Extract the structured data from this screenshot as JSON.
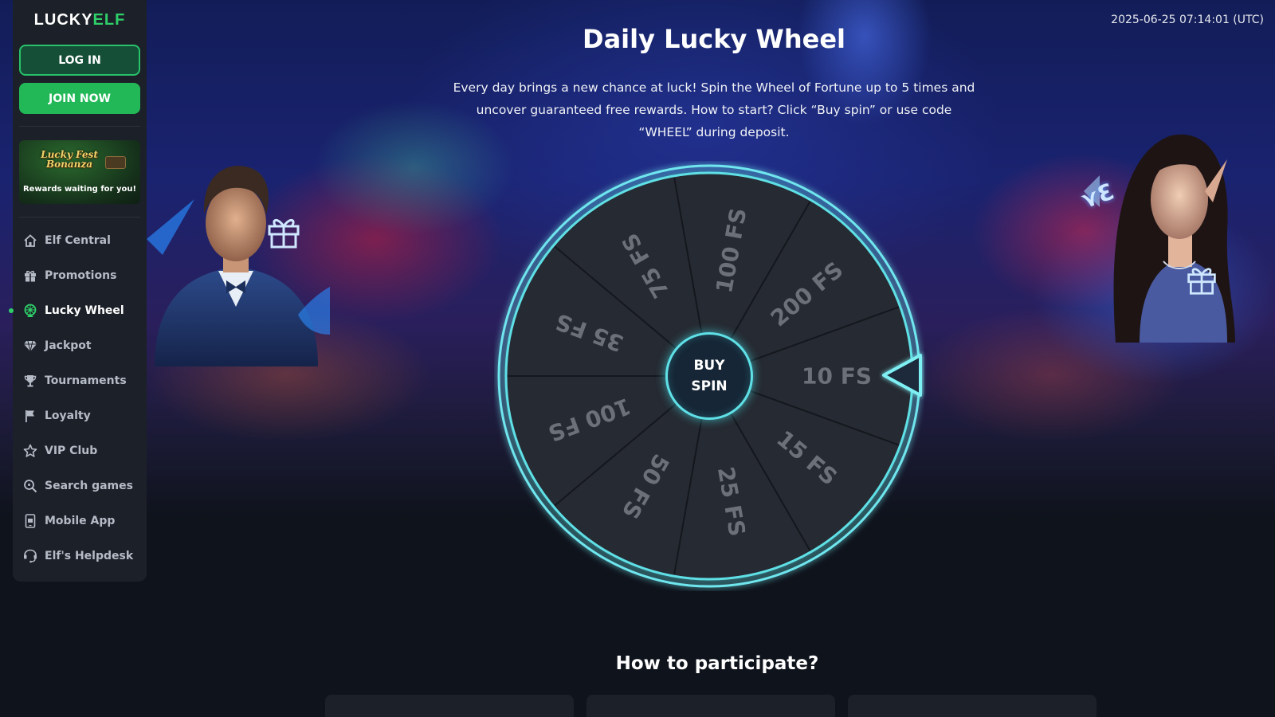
{
  "logo": {
    "lucky": "LUCKY",
    "elf": "ELF"
  },
  "auth": {
    "login": "LOG IN",
    "join": "JOIN NOW"
  },
  "promo_banner": {
    "title_line1": "Lucky Fest",
    "title_line2": "Bonanza",
    "caption": "Rewards waiting for you!"
  },
  "nav": [
    {
      "label": "Elf Central",
      "icon": "home-icon"
    },
    {
      "label": "Promotions",
      "icon": "gift-icon"
    },
    {
      "label": "Lucky Wheel",
      "icon": "wheel-icon",
      "active": true
    },
    {
      "label": "Jackpot",
      "icon": "diamond-icon"
    },
    {
      "label": "Tournaments",
      "icon": "trophy-icon"
    },
    {
      "label": "Loyalty",
      "icon": "flag-icon"
    },
    {
      "label": "VIP Club",
      "icon": "star-icon"
    },
    {
      "label": "Search games",
      "icon": "search-icon"
    },
    {
      "label": "Mobile App",
      "icon": "mobile-app-icon"
    },
    {
      "label": "Elf's Helpdesk",
      "icon": "helpdesk-icon"
    }
  ],
  "timestamp": "2025-06-25 07:14:01 (UTC)",
  "page": {
    "title": "Daily Lucky Wheel",
    "description": "Every day brings a new chance at luck! Spin the Wheel of Fortune up to 5 times and uncover guaranteed free rewards. How to start? Click “Buy spin” or use code “WHEEL” during deposit."
  },
  "wheel": {
    "segments": [
      "10 FS",
      "15 FS",
      "25 FS",
      "50 FS",
      "100 FS",
      "35 FS",
      "75 FS",
      "100 FS",
      "200 FS"
    ],
    "button_line1": "BUY",
    "button_line2": "SPIN"
  },
  "how": {
    "title": "How to participate?"
  },
  "colors": {
    "accent_green": "#2fd06a",
    "wheel_ring": "#5fe0e6",
    "wheel_segment": "#262a33",
    "segment_text": "#6b7079",
    "sidebar_bg": "#1c2028",
    "page_bg": "#0f131c"
  }
}
